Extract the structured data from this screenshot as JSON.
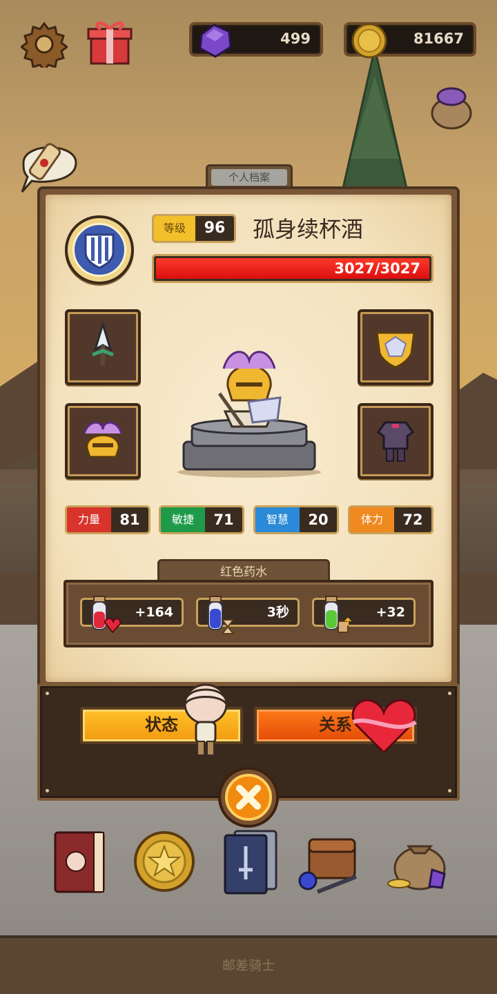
{
  "currency": {
    "gems": "499",
    "coins": "81667"
  },
  "profile": {
    "tab_label": "个人档案",
    "level_label": "等级",
    "level": "96",
    "name": "孤身续杯酒",
    "hp_text": "3027/3027",
    "hp_fraction": 1.0
  },
  "stats": [
    {
      "label": "力量",
      "value": "81"
    },
    {
      "label": "敏捷",
      "value": "71"
    },
    {
      "label": "智慧",
      "value": "20"
    },
    {
      "label": "体力",
      "value": "72"
    }
  ],
  "potion": {
    "title": "红色药水",
    "heal": "+164",
    "cooldown": "3秒",
    "bonus": "+32"
  },
  "buttons": {
    "status": "状态",
    "relation": "关系"
  },
  "footer": {
    "title": "邮差骑士"
  },
  "colors": {
    "strength": "#d8342c",
    "agility": "#1f9a4a",
    "wisdom": "#2a8ad8",
    "stamina": "#f08a20",
    "level_label": "#f1c02a",
    "hp_bar": "#e81c14"
  },
  "icons": {
    "top": [
      "gear-icon",
      "gift-icon",
      "gem-icon",
      "coin-icon",
      "scroll-icon",
      "gem-sack-icon"
    ],
    "equipment": [
      "spear-icon",
      "shield-icon",
      "helmet-icon",
      "armor-icon"
    ],
    "nav": [
      "book-icon",
      "star-coin-icon",
      "cards-icon",
      "backpack-icon",
      "treasure-sack-icon"
    ]
  }
}
